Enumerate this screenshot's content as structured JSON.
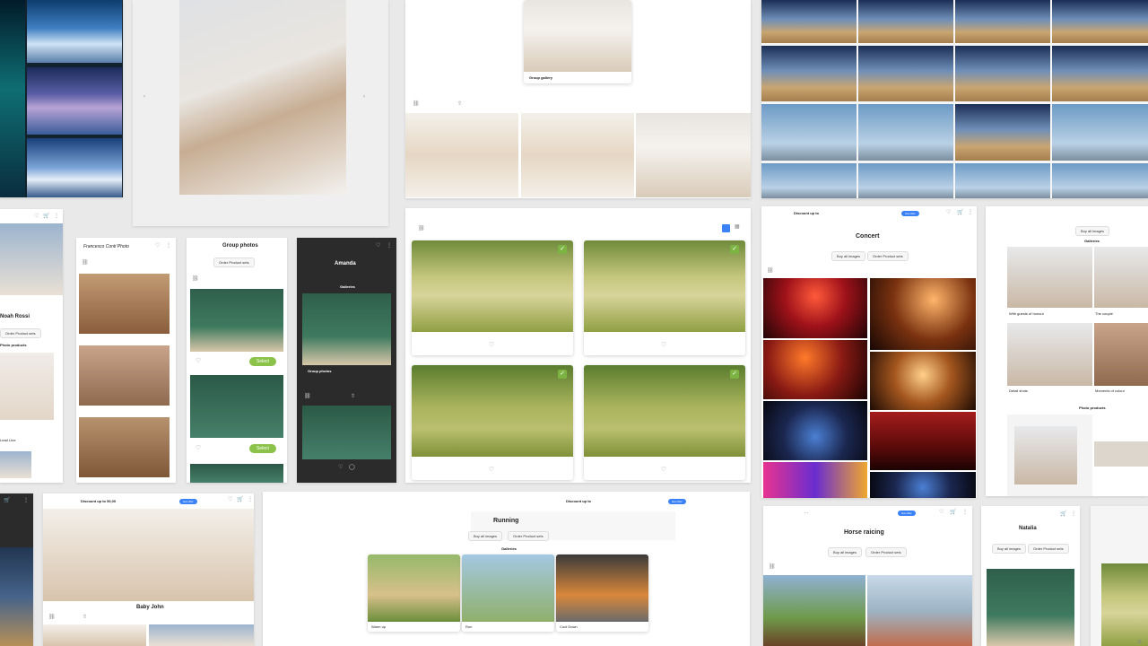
{
  "galleries": {
    "group_gallery": {
      "caption": "Group gallery"
    },
    "profile_left": {
      "name": "Noah Rossi",
      "section": "Photo products",
      "footer": "Lead Line"
    },
    "portrait_panel": {
      "brand": "Francesco Conti Photo"
    },
    "group_photos": {
      "title": "Group photos",
      "order_btn": "Order Product sets",
      "select_btn_1": "Select",
      "select_btn_2": "Select"
    },
    "amanda": {
      "title": "Amanda",
      "section": "Galleries",
      "caption": "Group photos"
    },
    "concert": {
      "discount": "Discount up to",
      "title": "Concert",
      "buy_btn": "Buy all images",
      "order_btn": "Order Product sets",
      "pill": "Get offer"
    },
    "wedding_right": {
      "buy_btn": "Buy all images",
      "section": "Galleries",
      "cap1": "With guests of honour",
      "cap2": "The couple",
      "cap3": "Detail shots",
      "cap4": "Moments of colour",
      "section2": "Photo products"
    },
    "baby_john": {
      "discount": "Discount up to 50,00",
      "title": "Baby John",
      "pill": "Get offer"
    },
    "running": {
      "discount": "Discount up to",
      "title": "Running",
      "buy_btn": "Buy all images",
      "order_btn": "Order Product sets",
      "section": "Galleries",
      "cap1": "Warm up",
      "cap2": "Run",
      "cap3": "Cool Down",
      "pill": "Get offer"
    },
    "horse": {
      "title": "Horse raicing",
      "buy_btn": "Buy all images",
      "order_btn": "Order Product sets",
      "pill": "Get offer"
    },
    "natalia": {
      "title": "Natalia",
      "buy_btn": "Buy all images",
      "order_btn": "Order Product sets"
    }
  },
  "icons": {
    "heart": "heart-icon",
    "cart": "cart-icon",
    "menu": "dots-icon",
    "link": "link-icon",
    "grid": "grid-icon"
  }
}
